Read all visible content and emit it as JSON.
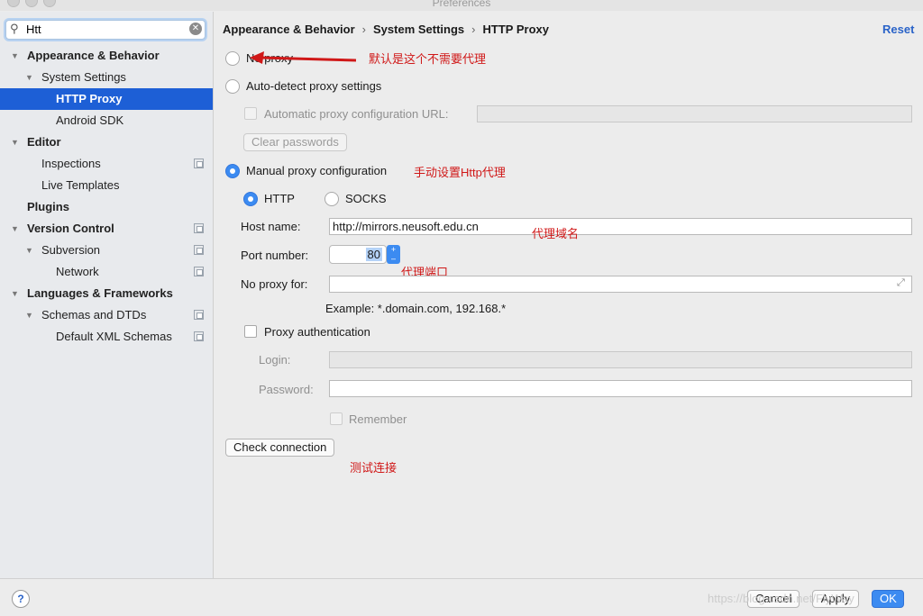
{
  "window": {
    "title": "Preferences"
  },
  "search": {
    "value": "Htt"
  },
  "sidebar": {
    "items": [
      {
        "label": "Appearance & Behavior"
      },
      {
        "label": "System Settings"
      },
      {
        "label": "HTTP Proxy"
      },
      {
        "label": "Android SDK"
      },
      {
        "label": "Editor"
      },
      {
        "label": "Inspections"
      },
      {
        "label": "Live Templates"
      },
      {
        "label": "Plugins"
      },
      {
        "label": "Version Control"
      },
      {
        "label": "Subversion"
      },
      {
        "label": "Network"
      },
      {
        "label": "Languages & Frameworks"
      },
      {
        "label": "Schemas and DTDs"
      },
      {
        "label": "Default XML Schemas"
      }
    ]
  },
  "breadcrumb": [
    "Appearance & Behavior",
    "System Settings",
    "HTTP Proxy"
  ],
  "reset_label": "Reset",
  "proxy": {
    "no_proxy": "No proxy",
    "auto_detect": "Auto-detect proxy settings",
    "auto_config_url": "Automatic proxy configuration URL:",
    "clear_passwords": "Clear passwords",
    "manual": "Manual proxy configuration",
    "http": "HTTP",
    "socks": "SOCKS",
    "host_label": "Host name:",
    "host_value": "http://mirrors.neusoft.edu.cn",
    "port_label": "Port number:",
    "port_value": "80",
    "no_proxy_for_label": "No proxy for:",
    "example": "Example: *.domain.com, 192.168.*",
    "proxy_auth": "Proxy authentication",
    "login_label": "Login:",
    "password_label": "Password:",
    "remember": "Remember",
    "check_connection": "Check connection"
  },
  "annotations": {
    "default_no_proxy": "默认是这个不需要代理",
    "manual_http": "手动设置Http代理",
    "proxy_domain": "代理域名",
    "proxy_port": "代理端口",
    "test_connection": "测试连接"
  },
  "footer": {
    "help": "?",
    "cancel": "Cancel",
    "apply": "Apply",
    "ok": "OK",
    "watermark": "https://blog.csdn.net/FlyWay"
  },
  "colors": {
    "accent": "#1d5fd6",
    "annotation": "#d01818",
    "link": "#2a63c8"
  }
}
